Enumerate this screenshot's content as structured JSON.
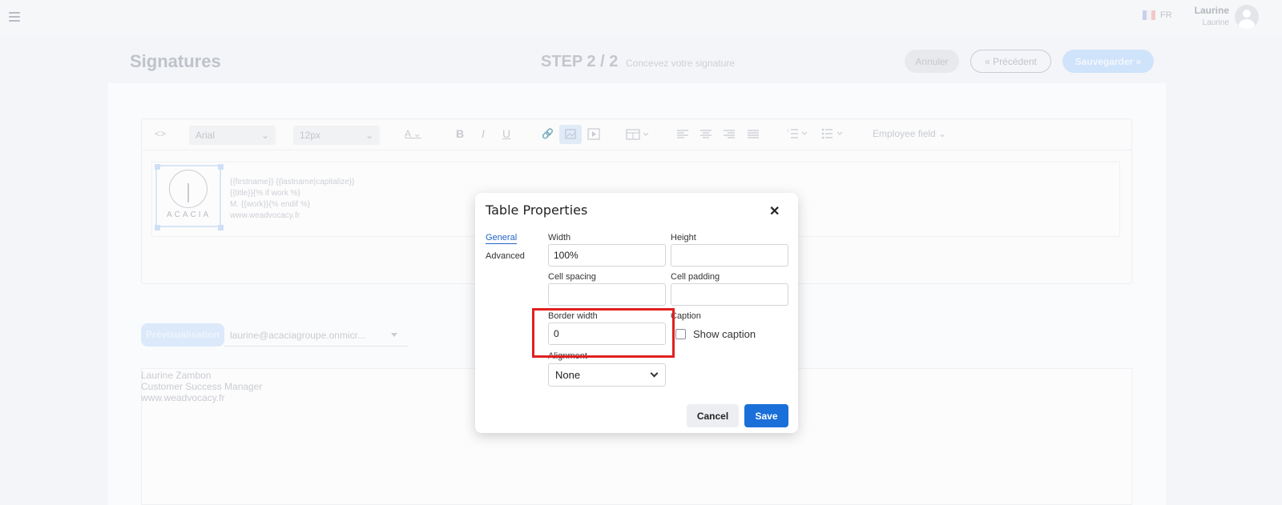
{
  "topbar": {
    "lang": "FR",
    "user_name": "Laurine",
    "user_sub": "Laurine"
  },
  "header": {
    "title": "Signatures",
    "step": "STEP 2 / 2",
    "step_sub": "Concevez votre signature",
    "cancel_label": "Annuler",
    "prev_label": "Précédent",
    "save_label": "Sauvegarder"
  },
  "toolbar": {
    "code_glyph": "<>",
    "font": "Arial",
    "size": "12px",
    "bold": "B",
    "italic": "I",
    "underline": "U",
    "employee_field": "Employee field"
  },
  "editor": {
    "logo_text": "ACACIA",
    "lines": [
      "{{firstname}} {{lastname|capitalize}}",
      "{{title}}{% if work %}",
      "M. {{work}}{% endif %}",
      "www.weadvocacy.fr"
    ]
  },
  "preview": {
    "button_label": "Prévisualisation",
    "selected_email": "laurine@acaciagroupe.onmicr...",
    "lines": [
      "Laurine Zambon",
      "Customer Success Manager",
      "www.weadvocacy.fr"
    ]
  },
  "modal": {
    "title": "Table Properties",
    "close_glyph": "✕",
    "tabs": [
      "General",
      "Advanced"
    ],
    "fields": {
      "width_label": "Width",
      "width_value": "100%",
      "height_label": "Height",
      "height_value": "",
      "cell_spacing_label": "Cell spacing",
      "cell_spacing_value": "",
      "cell_padding_label": "Cell padding",
      "cell_padding_value": "",
      "border_width_label": "Border width",
      "border_width_value": "0",
      "caption_label": "Caption",
      "show_caption_label": "Show caption",
      "alignment_label": "Alignment",
      "alignment_value": "None"
    },
    "cancel_label": "Cancel",
    "save_label": "Save"
  },
  "colors": {
    "accent": "#1a6fd8",
    "highlight": "#e02020"
  }
}
